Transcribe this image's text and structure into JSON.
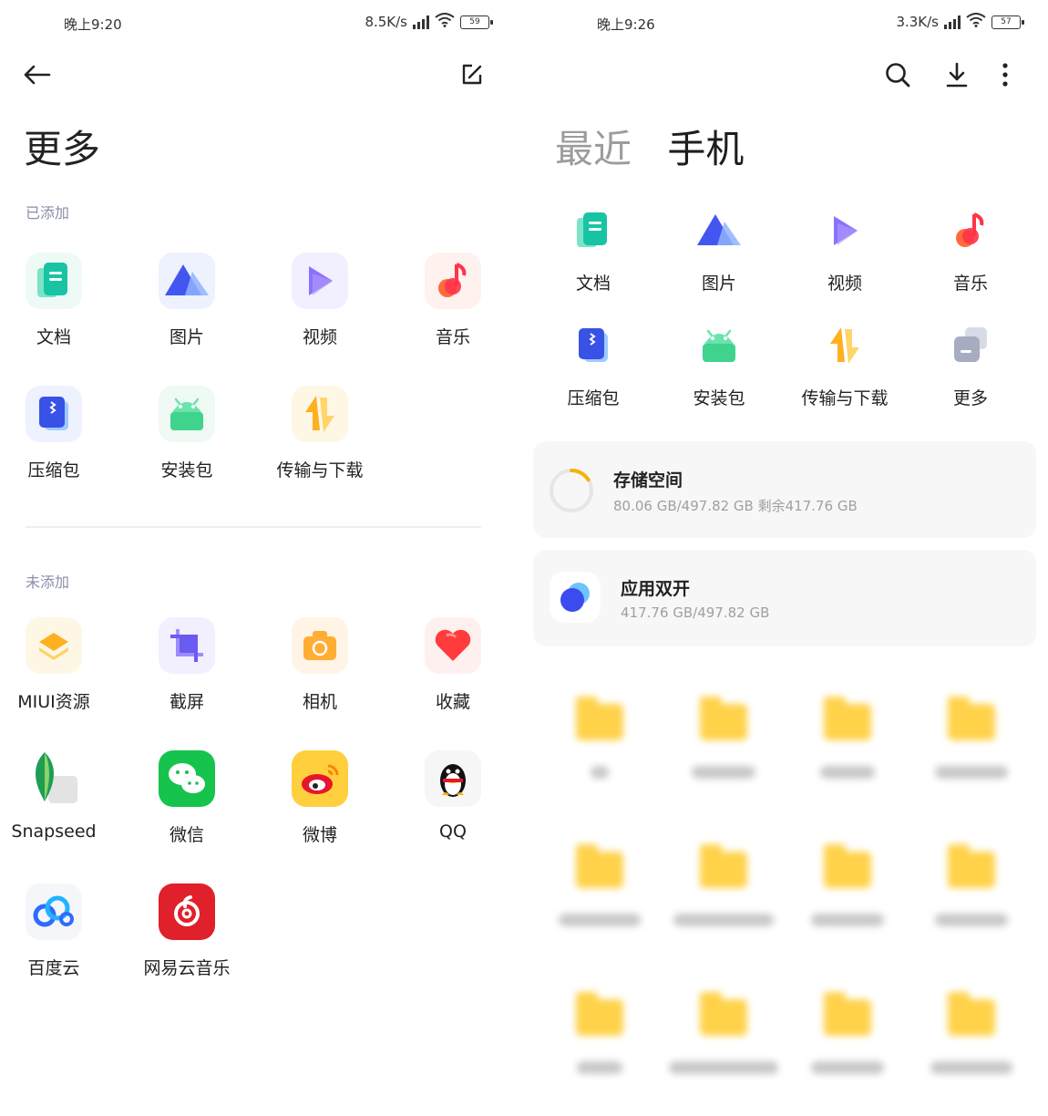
{
  "left": {
    "status": {
      "time": "晚上9:20",
      "speed": "8.5K/s",
      "battery": "59"
    },
    "title": "更多",
    "added_label": "已添加",
    "added_items": [
      {
        "label": "文档",
        "icon": "document-icon"
      },
      {
        "label": "图片",
        "icon": "image-icon"
      },
      {
        "label": "视频",
        "icon": "video-icon"
      },
      {
        "label": "音乐",
        "icon": "music-icon"
      },
      {
        "label": "压缩包",
        "icon": "zip-icon"
      },
      {
        "label": "安装包",
        "icon": "android-icon"
      },
      {
        "label": "传输与下载",
        "icon": "transfer-icon"
      }
    ],
    "not_added_label": "未添加",
    "not_added_items": [
      {
        "label": "MIUI资源",
        "icon": "miui-layers-icon"
      },
      {
        "label": "截屏",
        "icon": "crop-icon"
      },
      {
        "label": "相机",
        "icon": "camera-icon"
      },
      {
        "label": "收藏",
        "icon": "heart-icon"
      },
      {
        "label": "Snapseed",
        "icon": "snapseed-icon"
      },
      {
        "label": "微信",
        "icon": "wechat-icon"
      },
      {
        "label": "微博",
        "icon": "weibo-icon"
      },
      {
        "label": "QQ",
        "icon": "qq-icon"
      },
      {
        "label": "百度云",
        "icon": "baidu-cloud-icon"
      },
      {
        "label": "网易云音乐",
        "icon": "netease-music-icon"
      }
    ]
  },
  "right": {
    "status": {
      "time": "晚上9:26",
      "speed": "3.3K/s",
      "battery": "57"
    },
    "tabs": [
      {
        "label": "最近",
        "active": false
      },
      {
        "label": "手机",
        "active": true
      }
    ],
    "categories": [
      {
        "label": "文档",
        "icon": "document-icon"
      },
      {
        "label": "图片",
        "icon": "image-icon"
      },
      {
        "label": "视频",
        "icon": "video-icon"
      },
      {
        "label": "音乐",
        "icon": "music-icon"
      },
      {
        "label": "压缩包",
        "icon": "zip-icon"
      },
      {
        "label": "安装包",
        "icon": "android-icon"
      },
      {
        "label": "传输与下载",
        "icon": "transfer-icon"
      },
      {
        "label": "更多",
        "icon": "more-apps-icon"
      }
    ],
    "storage": {
      "title": "存储空间",
      "detail": "80.06 GB/497.82 GB  剩余417.76 GB",
      "used_fraction": 0.16
    },
    "dual_app": {
      "title": "应用双开",
      "detail": "417.76 GB/497.82 GB"
    },
    "folder_count": 12
  }
}
